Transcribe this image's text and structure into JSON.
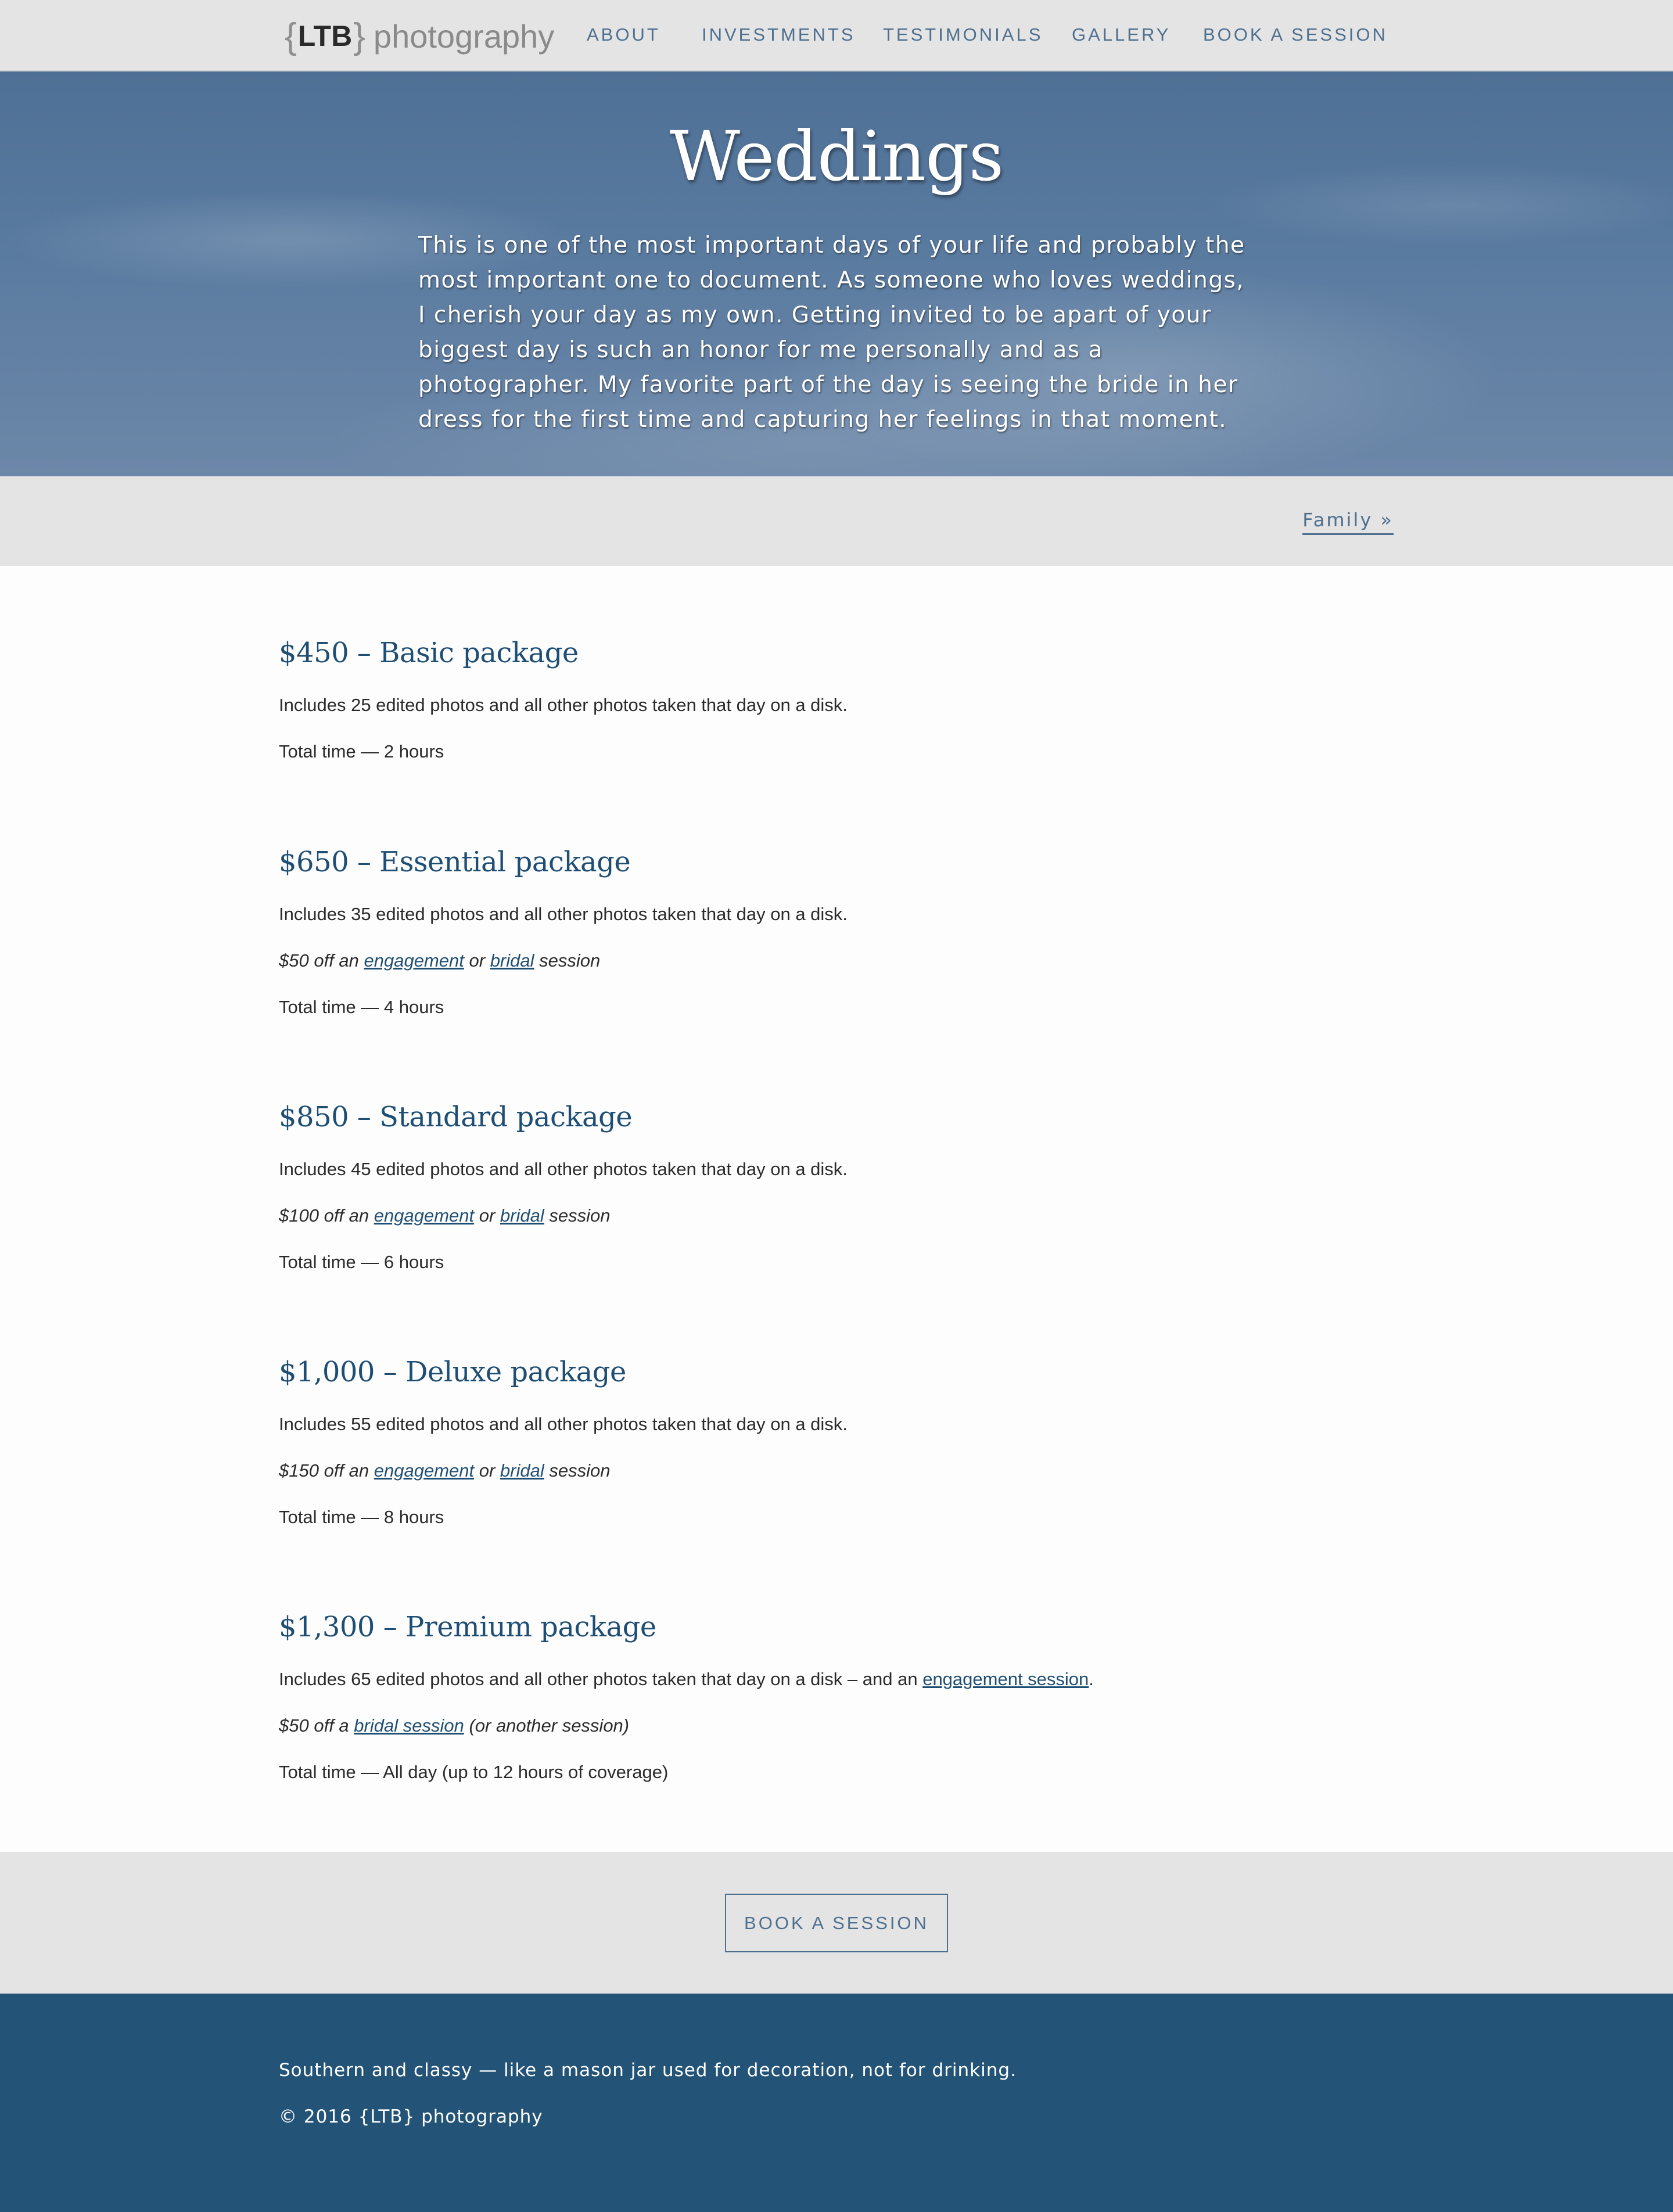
{
  "nav": {
    "logo": {
      "brace_open": "{",
      "ltb": "LTB",
      "brace_close": "}",
      "word": "photography"
    },
    "links": [
      {
        "label": "ABOUT"
      },
      {
        "label": "INVESTMENTS"
      },
      {
        "label": "TESTIMONIALS"
      },
      {
        "label": "GALLERY"
      },
      {
        "label": "BOOK A SESSION"
      }
    ]
  },
  "hero": {
    "title": "Weddings",
    "text": "This is one of the most important days of your life and probably the most important one to document. As someone who loves weddings, I cherish your day as my own. Getting invited to be apart of your biggest day is such an honor for me personally and as a photographer. My favorite part of the day is seeing the bride in her dress for the first time and capturing her feelings in that moment."
  },
  "subnav": {
    "next_link": "Family »"
  },
  "packages": [
    {
      "title": "$450 – Basic package",
      "includes": "Includes 25 edited photos and all other photos taken that day on a disk.",
      "total": "Total time — 2 hours"
    },
    {
      "title": "$650 – Essential package",
      "includes": "Includes 35 edited photos and all other photos taken that day on a disk.",
      "discount": {
        "prefix": "$50 off an ",
        "link1": "engagement",
        "mid": " or ",
        "link2": "bridal",
        "suffix": " session"
      },
      "total": "Total time — 4 hours"
    },
    {
      "title": "$850 – Standard package",
      "includes": "Includes 45 edited photos and all other photos taken that day on a disk.",
      "discount": {
        "prefix": "$100 off an ",
        "link1": "engagement",
        "mid": " or ",
        "link2": "bridal",
        "suffix": " session"
      },
      "total": "Total time — 6 hours"
    },
    {
      "title": "$1,000 – Deluxe package",
      "includes": "Includes 55 edited photos and all other photos taken that day on a disk.",
      "discount": {
        "prefix": "$150 off an ",
        "link1": "engagement",
        "mid": " or ",
        "link2": "bridal",
        "suffix": " session"
      },
      "total": "Total time — 8 hours"
    },
    {
      "title": "$1,300 – Premium package",
      "includes_prefix": "Includes 65 edited photos and all other photos taken that day on a disk – and an ",
      "includes_link": "engagement session",
      "includes_suffix": ".",
      "discount": {
        "prefix": "$50 off a ",
        "link": "bridal session",
        "suffix": " (or another session)"
      },
      "total": "Total time — All day (up to 12 hours of coverage)"
    }
  ],
  "cta": {
    "label": "BOOK A SESSION"
  },
  "footer": {
    "tagline": "Southern and classy — like a mason jar used for decoration, not for drinking.",
    "copyright": "© 2016 {LTB} photography"
  },
  "colors": {
    "accent": "#1f4e74",
    "nav_link": "#4e6f8e",
    "band_gray": "#e4e4e4",
    "footer_bg": "#235478"
  }
}
